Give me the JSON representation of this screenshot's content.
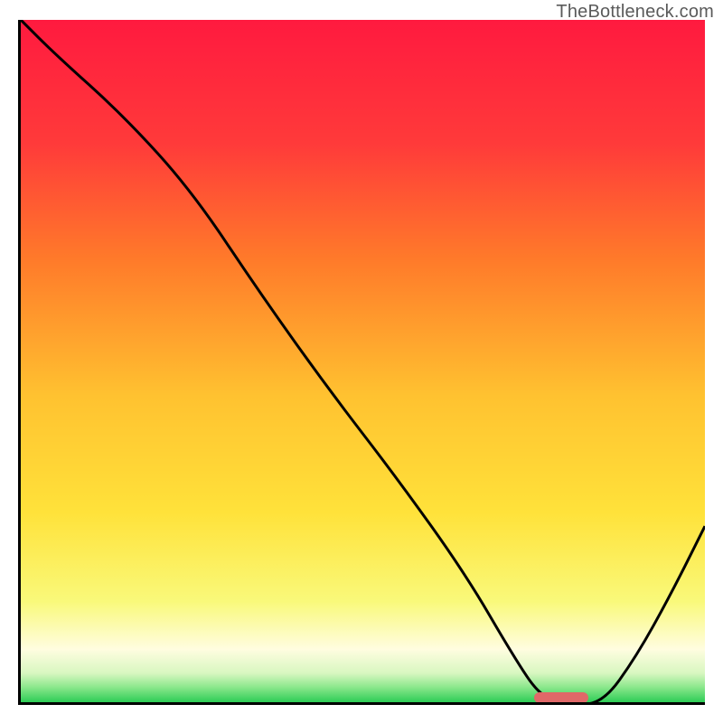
{
  "watermark": "TheBottleneck.com",
  "chart_data": {
    "type": "line",
    "title": "",
    "xlabel": "",
    "ylabel": "",
    "xlim": [
      0,
      100
    ],
    "ylim": [
      0,
      100
    ],
    "series": [
      {
        "name": "bottleneck-curve",
        "x": [
          0,
          5,
          15,
          25,
          35,
          45,
          55,
          65,
          72,
          76,
          80,
          85,
          90,
          95,
          100
        ],
        "values": [
          100,
          95,
          86,
          75,
          60,
          46,
          33,
          19,
          7,
          1,
          0,
          0,
          7,
          16,
          26
        ]
      }
    ],
    "optimum_marker": {
      "x_start": 75,
      "x_end": 83,
      "y": 0.7,
      "color": "#e06868"
    },
    "gradient_stops": [
      {
        "pos": 0,
        "color": "#ff1a3f"
      },
      {
        "pos": 18,
        "color": "#ff3a3a"
      },
      {
        "pos": 35,
        "color": "#ff7a2a"
      },
      {
        "pos": 55,
        "color": "#ffc230"
      },
      {
        "pos": 72,
        "color": "#ffe23a"
      },
      {
        "pos": 85,
        "color": "#f9f97a"
      },
      {
        "pos": 92,
        "color": "#fffde0"
      },
      {
        "pos": 95.5,
        "color": "#d8f7c0"
      },
      {
        "pos": 97.5,
        "color": "#8de88d"
      },
      {
        "pos": 100,
        "color": "#22c94f"
      }
    ]
  }
}
